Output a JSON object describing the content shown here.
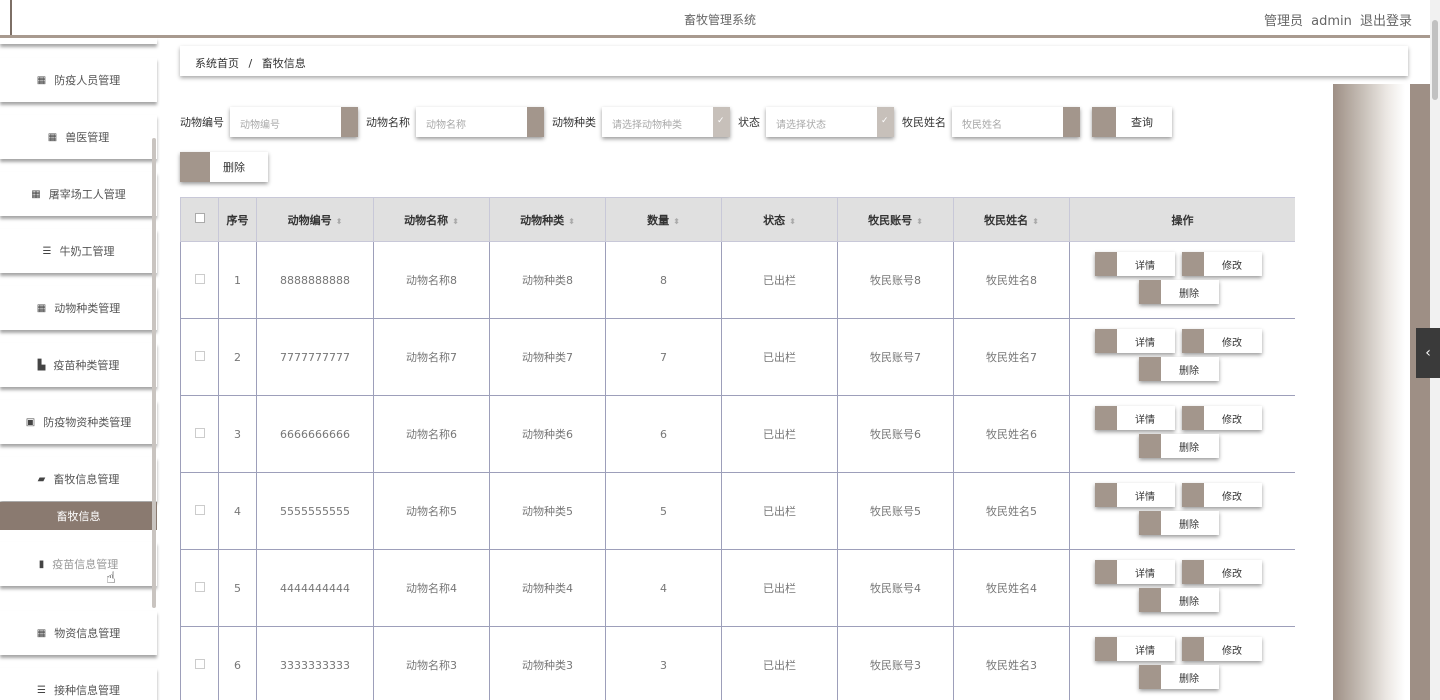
{
  "header": {
    "title": "畜牧管理系统",
    "user_role": "管理员",
    "username": "admin",
    "logout": "退出登录"
  },
  "sidebar": {
    "items": [
      {
        "label": "防疫人员管理",
        "icon": "grid-icon"
      },
      {
        "label": "兽医管理",
        "icon": "grid-icon"
      },
      {
        "label": "屠宰场工人管理",
        "icon": "grid-icon"
      },
      {
        "label": "牛奶工管理",
        "icon": "list-icon"
      },
      {
        "label": "动物种类管理",
        "icon": "grid-icon"
      },
      {
        "label": "疫苗种类管理",
        "icon": "stamp-icon"
      },
      {
        "label": "防疫物资种类管理",
        "icon": "clipboard-icon"
      },
      {
        "label": "畜牧信息管理",
        "icon": "ticket-icon"
      },
      {
        "label": "畜牧信息",
        "icon": ""
      },
      {
        "label": "疫苗信息管理",
        "icon": "bar-chart-icon"
      },
      {
        "label": "物资信息管理",
        "icon": "grid-icon"
      },
      {
        "label": "接种信息管理",
        "icon": "list-icon"
      }
    ]
  },
  "breadcrumb": {
    "home": "系统首页",
    "separator": "/",
    "current": "畜牧信息"
  },
  "search": {
    "animal_no_label": "动物编号",
    "animal_no_placeholder": "动物编号",
    "animal_name_label": "动物名称",
    "animal_name_placeholder": "动物名称",
    "animal_type_label": "动物种类",
    "animal_type_placeholder": "请选择动物种类",
    "status_label": "状态",
    "status_placeholder": "请选择状态",
    "herder_name_label": "牧民姓名",
    "herder_name_placeholder": "牧民姓名",
    "query_button": "查询"
  },
  "toolbar": {
    "delete_button": "删除"
  },
  "table": {
    "columns": [
      "序号",
      "动物编号",
      "动物名称",
      "动物种类",
      "数量",
      "状态",
      "牧民账号",
      "牧民姓名",
      "操作"
    ],
    "rows": [
      {
        "index": "1",
        "no": "8888888888",
        "name": "动物名称8",
        "type": "动物种类8",
        "qty": "8",
        "status": "已出栏",
        "account": "牧民账号8",
        "herder": "牧民姓名8"
      },
      {
        "index": "2",
        "no": "7777777777",
        "name": "动物名称7",
        "type": "动物种类7",
        "qty": "7",
        "status": "已出栏",
        "account": "牧民账号7",
        "herder": "牧民姓名7"
      },
      {
        "index": "3",
        "no": "6666666666",
        "name": "动物名称6",
        "type": "动物种类6",
        "qty": "6",
        "status": "已出栏",
        "account": "牧民账号6",
        "herder": "牧民姓名6"
      },
      {
        "index": "4",
        "no": "5555555555",
        "name": "动物名称5",
        "type": "动物种类5",
        "qty": "5",
        "status": "已出栏",
        "account": "牧民账号5",
        "herder": "牧民姓名5"
      },
      {
        "index": "5",
        "no": "4444444444",
        "name": "动物名称4",
        "type": "动物种类4",
        "qty": "4",
        "status": "已出栏",
        "account": "牧民账号4",
        "herder": "牧民姓名4"
      },
      {
        "index": "6",
        "no": "3333333333",
        "name": "动物名称3",
        "type": "动物种类3",
        "qty": "3",
        "status": "已出栏",
        "account": "牧民账号3",
        "herder": "牧民姓名3"
      }
    ],
    "actions": {
      "detail": "详情",
      "edit": "修改",
      "delete": "删除"
    }
  },
  "colors": {
    "accent": "#a3968c",
    "active_menu": "#8a7a70"
  }
}
